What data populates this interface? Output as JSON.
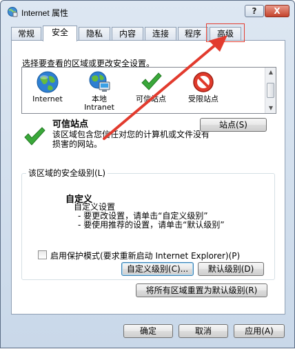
{
  "window": {
    "title": "Internet 属性",
    "help_label": "?",
    "close_label": "X"
  },
  "tabs": [
    {
      "label": "常规",
      "active": false
    },
    {
      "label": "安全",
      "active": true
    },
    {
      "label": "隐私",
      "active": false
    },
    {
      "label": "内容",
      "active": false
    },
    {
      "label": "连接",
      "active": false
    },
    {
      "label": "程序",
      "active": false
    },
    {
      "label": "高级",
      "active": false
    }
  ],
  "security": {
    "instruction": "选择要查看的区域或更改安全设置。",
    "zones": [
      {
        "label": "Internet",
        "label2": "",
        "icon": "globe-icon"
      },
      {
        "label": "本地",
        "label2": "Intranet",
        "icon": "intranet-globe-icon"
      },
      {
        "label": "可信站点",
        "label2": "",
        "icon": "checkmark-icon"
      },
      {
        "label": "受限站点",
        "label2": "",
        "icon": "no-entry-icon"
      }
    ],
    "selected_zone": {
      "title": "可信站点",
      "description": "该区域包含您信任对您的计算机或文件没有损害的网站。",
      "sites_button": "站点(S)"
    },
    "level_group": {
      "title": "该区域的安全级别(L)",
      "custom_title": "自定义",
      "custom_lines": [
        "自定义设置",
        "- 要更改设置，请单击“自定义级别”",
        "- 要使用推荐的设置，请单击“默认级别”"
      ],
      "protected_mode_label": "启用保护模式(要求重新启动 Internet Explorer)(P)",
      "protected_mode_checked": false,
      "custom_level_button": "自定义级别(C)...",
      "default_level_button": "默认级别(D)"
    },
    "reset_all_button": "将所有区域重置为默认级别(R)"
  },
  "footer": {
    "ok": "确定",
    "cancel": "取消",
    "apply": "应用(A)"
  },
  "colors": {
    "annotation_red": "#e23b2e",
    "check_green": "#3aa83a"
  }
}
